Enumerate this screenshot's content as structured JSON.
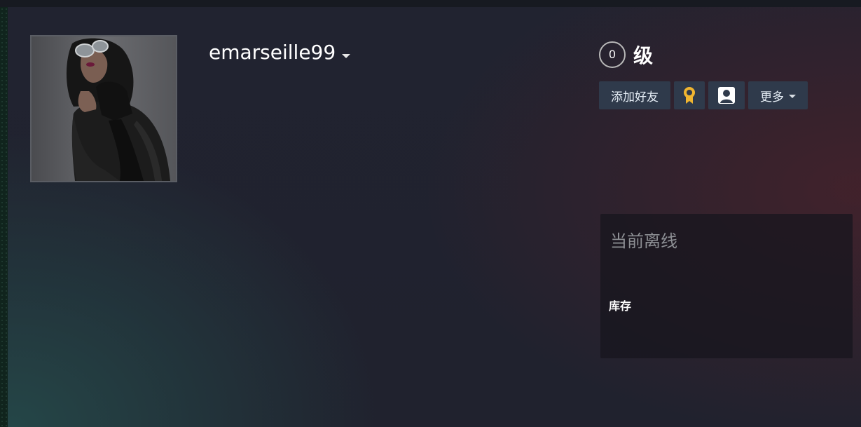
{
  "profile": {
    "username": "emarseille99",
    "level_value": "0",
    "level_label": "级"
  },
  "actions": {
    "add_friend_label": "添加好友",
    "badge_icon": "award-ribbon-icon",
    "profile_icon": "user-portrait-icon",
    "more_label": "更多"
  },
  "status": {
    "title": "当前离线",
    "inventory_label": "库存"
  },
  "colors": {
    "page_bg": "#20222f",
    "button_bg": "#2f3a4b",
    "badge_gold": "#f0b530",
    "muted_text": "#8d8f94"
  }
}
